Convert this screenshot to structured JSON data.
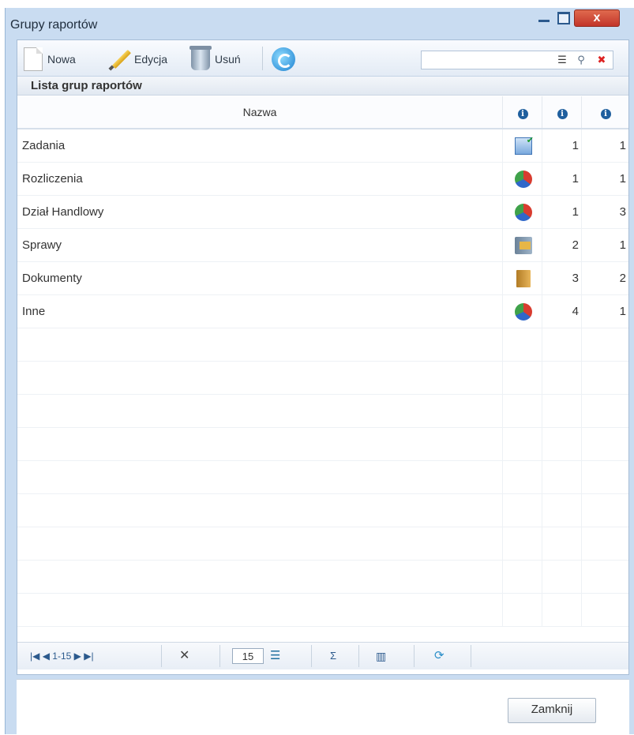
{
  "window": {
    "title": "Grupy raportów",
    "close_glyph": "x"
  },
  "toolbar": {
    "new_label": "Nowa",
    "edit_label": "Edycja",
    "delete_label": "Usuń"
  },
  "search": {
    "value": "",
    "placeholder": ""
  },
  "list": {
    "title": "Lista grup raportów",
    "columns": {
      "name": "Nazwa",
      "info_glyph": "i"
    },
    "rows": [
      {
        "name": "Zadania",
        "icon": "tasks-icon",
        "c1": "1",
        "c2": "1"
      },
      {
        "name": "Rozliczenia",
        "icon": "pie-chart-icon",
        "c1": "1",
        "c2": "1"
      },
      {
        "name": "Dział Handlowy",
        "icon": "pie-chart-icon",
        "c1": "1",
        "c2": "3"
      },
      {
        "name": "Sprawy",
        "icon": "case-folder-icon",
        "c1": "2",
        "c2": "1"
      },
      {
        "name": "Dokumenty",
        "icon": "document-binder-icon",
        "c1": "3",
        "c2": "2"
      },
      {
        "name": "Inne",
        "icon": "pie-chart-icon",
        "c1": "4",
        "c2": "1"
      }
    ],
    "empty_rows": 9
  },
  "pager": {
    "range_text": "1-15",
    "page_size": "15"
  },
  "footer": {
    "close_label": "Zamknij"
  },
  "colors": {
    "window_bg": "#c9dcf1",
    "accent": "#2c5a8d",
    "close_red": "#c2352a"
  }
}
